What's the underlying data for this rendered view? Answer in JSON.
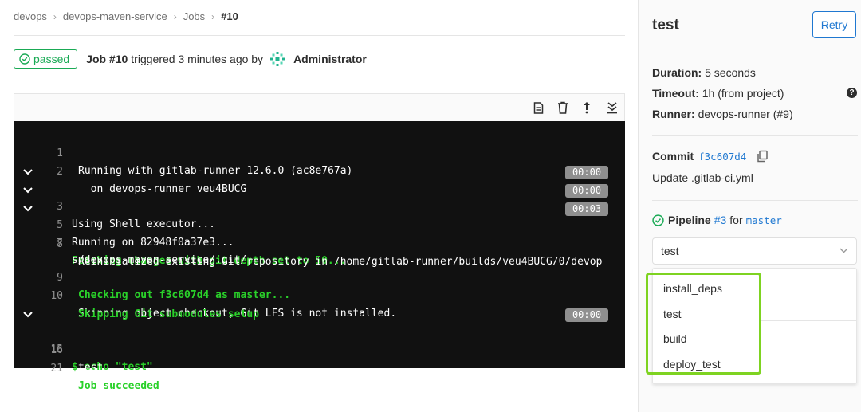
{
  "breadcrumb": {
    "group": "devops",
    "project": "devops-maven-service",
    "section": "Jobs",
    "current": "#10"
  },
  "header": {
    "status": "passed",
    "job_label": "Job #10",
    "triggered_text": "triggered 3 minutes ago by",
    "user": "Administrator"
  },
  "toolbar": {
    "icons": [
      "raw-log-icon",
      "erase-log-icon",
      "scroll-top-icon",
      "scroll-bottom-icon"
    ]
  },
  "log": {
    "lines": [
      {
        "n": "1",
        "text": "Running with gitlab-runner 12.6.0 (ac8e767a)"
      },
      {
        "n": "2",
        "text": "  on devops-runner veu4BUCG"
      },
      {
        "n": "3",
        "text": "Using Shell executor...",
        "duration": "00:00"
      },
      {
        "n": "5",
        "text": "Running on 82948f0a37e3...",
        "duration": "00:00"
      },
      {
        "n": "7",
        "text": "Fetching changes with git depth set to 50...",
        "duration": "00:03"
      },
      {
        "n": "8",
        "text": "Reinitialized existing Git repository in /home/gitlab-runner/builds/veu4BUCG/0/devop"
      },
      {
        "n": "",
        "text": "s/devops-maven-service/.git/"
      },
      {
        "n": "9",
        "text": "Checking out f3c607d4 as master..."
      },
      {
        "n": "10",
        "text": "Skipping object checkout, Git LFS is not installed."
      },
      {
        "n": "",
        "text": "Skipping Git submodules setup"
      },
      {
        "n": "15",
        "text": "$ echo \"test\"",
        "duration": "00:00"
      },
      {
        "n": "16",
        "text": "test"
      },
      {
        "n": "21",
        "text": "Job succeeded"
      }
    ]
  },
  "sidebar": {
    "title": "test",
    "retry_label": "Retry",
    "duration_label": "Duration:",
    "duration_value": "5 seconds",
    "timeout_label": "Timeout:",
    "timeout_value": "1h (from project)",
    "runner_label": "Runner:",
    "runner_value": "devops-runner (#9)",
    "commit_label": "Commit",
    "commit_sha": "f3c607d4",
    "commit_message": "Update .gitlab-ci.yml",
    "pipeline_label": "Pipeline",
    "pipeline_id": "#3",
    "pipeline_for": "for",
    "pipeline_branch": "master",
    "stage_selected": "test",
    "stage_options": [
      "install_deps",
      "test",
      "build",
      "deploy_test"
    ]
  },
  "colors": {
    "success": "#1aaa55",
    "link": "#1f78d1",
    "log_bg": "#111111",
    "log_green": "#2ad12a",
    "highlight": "#7ed321"
  }
}
